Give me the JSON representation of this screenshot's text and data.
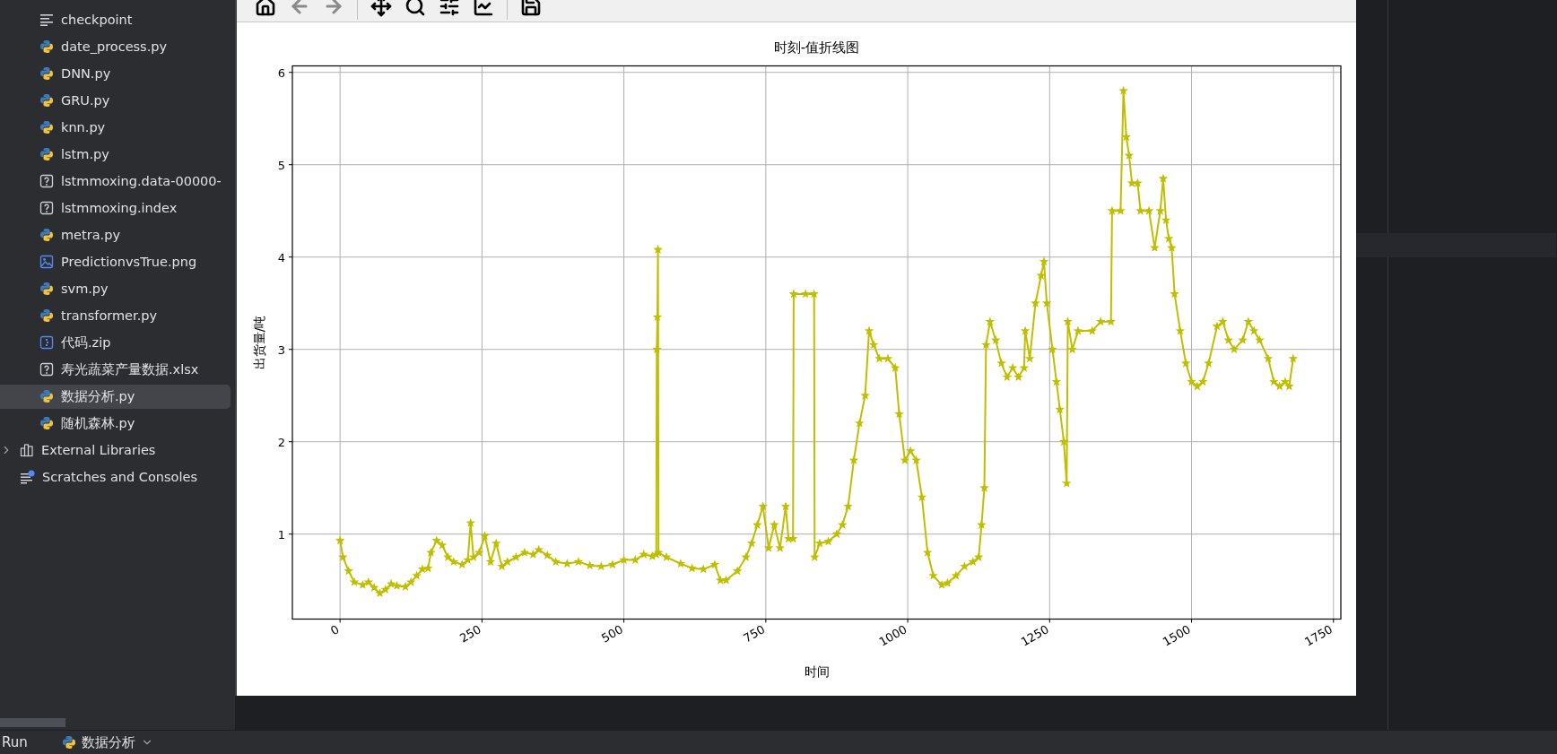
{
  "project_tree": {
    "files": [
      {
        "label": "checkpoint",
        "kind": "text",
        "selected": false
      },
      {
        "label": "date_process.py",
        "kind": "python",
        "selected": false
      },
      {
        "label": "DNN.py",
        "kind": "python",
        "selected": false
      },
      {
        "label": "GRU.py",
        "kind": "python",
        "selected": false
      },
      {
        "label": "knn.py",
        "kind": "python",
        "selected": false
      },
      {
        "label": "lstm.py",
        "kind": "python",
        "selected": false
      },
      {
        "label": "lstmmoxing.data-00000-",
        "kind": "unknown",
        "selected": false
      },
      {
        "label": "lstmmoxing.index",
        "kind": "unknown",
        "selected": false
      },
      {
        "label": "metra.py",
        "kind": "python",
        "selected": false
      },
      {
        "label": "PredictionvsTrue.png",
        "kind": "image",
        "selected": false
      },
      {
        "label": "svm.py",
        "kind": "python",
        "selected": false
      },
      {
        "label": "transformer.py",
        "kind": "python",
        "selected": false
      },
      {
        "label": "代码.zip",
        "kind": "zip",
        "selected": false
      },
      {
        "label": "寿光蔬菜产量数据.xlsx",
        "kind": "unknown",
        "selected": false
      },
      {
        "label": "数据分析.py",
        "kind": "python",
        "selected": true
      },
      {
        "label": "随机森林.py",
        "kind": "python",
        "selected": false
      }
    ],
    "roots": [
      {
        "label": "External Libraries",
        "kind": "library",
        "expanded": false
      },
      {
        "label": "Scratches and Consoles",
        "kind": "scratches"
      }
    ]
  },
  "figure_window": {
    "toolbar": [
      {
        "kind": "home",
        "disabled": false
      },
      {
        "kind": "back",
        "disabled": true
      },
      {
        "kind": "forward",
        "disabled": true
      },
      {
        "kind": "separator"
      },
      {
        "kind": "pan",
        "disabled": false
      },
      {
        "kind": "zoom",
        "disabled": false
      },
      {
        "kind": "subplots",
        "disabled": false
      },
      {
        "kind": "edit",
        "disabled": false
      },
      {
        "kind": "separator"
      },
      {
        "kind": "save",
        "disabled": false
      }
    ],
    "chart_data": {
      "type": "line",
      "title": "时刻-值折线图",
      "xlabel": "时间",
      "ylabel": "出货量/吨",
      "xlim": [
        -84,
        1763
      ],
      "ylim": [
        0.08,
        6.07
      ],
      "grid": true,
      "xticks": [
        0,
        250,
        500,
        750,
        1000,
        1250,
        1500,
        1750
      ],
      "yticks": [
        1,
        2,
        3,
        4,
        5,
        6
      ],
      "x": [
        0,
        5,
        15,
        25,
        40,
        50,
        60,
        70,
        80,
        90,
        100,
        115,
        125,
        135,
        145,
        155,
        160,
        170,
        180,
        190,
        200,
        215,
        225,
        230,
        235,
        245,
        255,
        265,
        275,
        285,
        295,
        310,
        325,
        340,
        350,
        365,
        380,
        400,
        420,
        440,
        460,
        480,
        500,
        520,
        535,
        550,
        557,
        558,
        559,
        560,
        561,
        575,
        600,
        620,
        640,
        660,
        670,
        680,
        700,
        715,
        725,
        735,
        745,
        755,
        765,
        775,
        785,
        790,
        798,
        799,
        820,
        835,
        836,
        845,
        860,
        875,
        885,
        895,
        905,
        915,
        925,
        932,
        940,
        950,
        965,
        978,
        985,
        995,
        1005,
        1015,
        1025,
        1035,
        1045,
        1060,
        1070,
        1085,
        1100,
        1115,
        1125,
        1130,
        1135,
        1138,
        1145,
        1155,
        1165,
        1175,
        1185,
        1195,
        1205,
        1207,
        1215,
        1225,
        1235,
        1240,
        1245,
        1255,
        1262,
        1268,
        1275,
        1280,
        1282,
        1290,
        1300,
        1325,
        1340,
        1358,
        1360,
        1375,
        1380,
        1385,
        1390,
        1395,
        1405,
        1410,
        1425,
        1435,
        1445,
        1450,
        1455,
        1460,
        1465,
        1470,
        1480,
        1490,
        1500,
        1510,
        1520,
        1530,
        1545,
        1555,
        1565,
        1575,
        1590,
        1600,
        1610,
        1620,
        1635,
        1645,
        1655,
        1665,
        1672,
        1679
      ],
      "series": [
        {
          "color": "#bfbf00",
          "marker": "*",
          "values": [
            0.93,
            0.75,
            0.6,
            0.48,
            0.45,
            0.48,
            0.42,
            0.36,
            0.4,
            0.46,
            0.44,
            0.43,
            0.48,
            0.55,
            0.62,
            0.63,
            0.8,
            0.93,
            0.88,
            0.75,
            0.7,
            0.67,
            0.72,
            1.12,
            0.75,
            0.8,
            0.98,
            0.7,
            0.9,
            0.65,
            0.7,
            0.75,
            0.8,
            0.78,
            0.83,
            0.77,
            0.7,
            0.68,
            0.7,
            0.66,
            0.65,
            0.67,
            0.72,
            0.72,
            0.78,
            0.76,
            0.78,
            3.0,
            3.35,
            4.08,
            0.8,
            0.75,
            0.68,
            0.63,
            0.62,
            0.67,
            0.5,
            0.5,
            0.6,
            0.75,
            0.9,
            1.1,
            1.3,
            0.85,
            1.1,
            0.85,
            1.3,
            0.95,
            0.95,
            3.6,
            3.6,
            3.6,
            0.75,
            0.9,
            0.92,
            1.0,
            1.1,
            1.3,
            1.8,
            2.2,
            2.5,
            3.2,
            3.05,
            2.9,
            2.9,
            2.8,
            2.3,
            1.8,
            1.9,
            1.8,
            1.4,
            0.8,
            0.55,
            0.45,
            0.47,
            0.55,
            0.65,
            0.7,
            0.75,
            1.1,
            1.5,
            3.05,
            3.3,
            3.1,
            2.85,
            2.7,
            2.8,
            2.7,
            2.8,
            3.2,
            2.9,
            3.5,
            3.8,
            3.95,
            3.5,
            3.0,
            2.65,
            2.35,
            2.0,
            1.55,
            3.3,
            3.0,
            3.2,
            3.2,
            3.3,
            3.3,
            4.5,
            4.5,
            5.8,
            5.3,
            5.1,
            4.8,
            4.8,
            4.5,
            4.5,
            4.1,
            4.5,
            4.85,
            4.4,
            4.2,
            4.1,
            3.6,
            3.2,
            2.85,
            2.65,
            2.6,
            2.65,
            2.85,
            3.25,
            3.3,
            3.1,
            3.0,
            3.1,
            3.3,
            3.2,
            3.1,
            2.9,
            2.65,
            2.6,
            2.65,
            2.6,
            2.9
          ]
        }
      ]
    }
  },
  "run_bar": {
    "label": "Run",
    "tab": "数据分析"
  }
}
